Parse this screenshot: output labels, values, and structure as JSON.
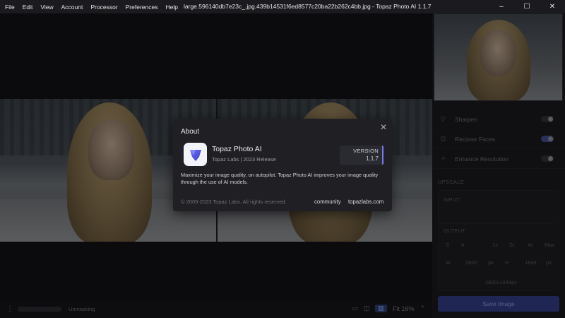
{
  "menu": [
    "File",
    "Edit",
    "View",
    "Account",
    "Processor",
    "Preferences",
    "Help"
  ],
  "window": {
    "title": "large.596140db7e23c_.jpg.439b14531f6ed8577c20ba22b262c4bb.jpg - Topaz Photo AI 1.1.7",
    "controls": [
      "–",
      "☐",
      "✕"
    ]
  },
  "status": {
    "label": "Unmasking",
    "view_modes": [
      "▭",
      "◫",
      "▥",
      "Fit 16%",
      "⌃"
    ]
  },
  "panel": {
    "rows": [
      {
        "icon": "sharpen-icon",
        "label": "Sharpen",
        "on": false
      },
      {
        "icon": "recover-faces-icon",
        "label": "Recover Faces",
        "on": true
      },
      {
        "icon": "enhance-resolution-icon",
        "label": "Enhance Resolution",
        "on": false
      }
    ],
    "upscale_label": "UPSCALE",
    "input_label": "INPUT",
    "output_label": "OUTPUT",
    "scale_label": "S",
    "scale_value": "4",
    "scale_options": [
      "1x",
      "2x",
      "4x",
      "Max"
    ],
    "width_label": "W",
    "width_value": "2800",
    "height_label": "H",
    "height_value": "1848",
    "unit": "px",
    "output_size": "2800x1848px",
    "save_label": "Save Image"
  },
  "about": {
    "title": "About",
    "app_name": "Topaz Photo AI",
    "app_sub": "Topaz Labs | 2023 Release",
    "version_label": "VERSION",
    "version_value": "1.1.7",
    "description": "Maximize your image quality, on autopilot. Topaz Photo AI improves your image quality through the use of AI models.",
    "copyright": "© 2009-2023 Topaz Labs. All rights reserved.",
    "link_community": "community",
    "link_site": "topazlabs.com"
  },
  "colors": {
    "accent": "#7a7af0",
    "dialog_bg": "#1f1f24",
    "save_button": "#313b82"
  }
}
